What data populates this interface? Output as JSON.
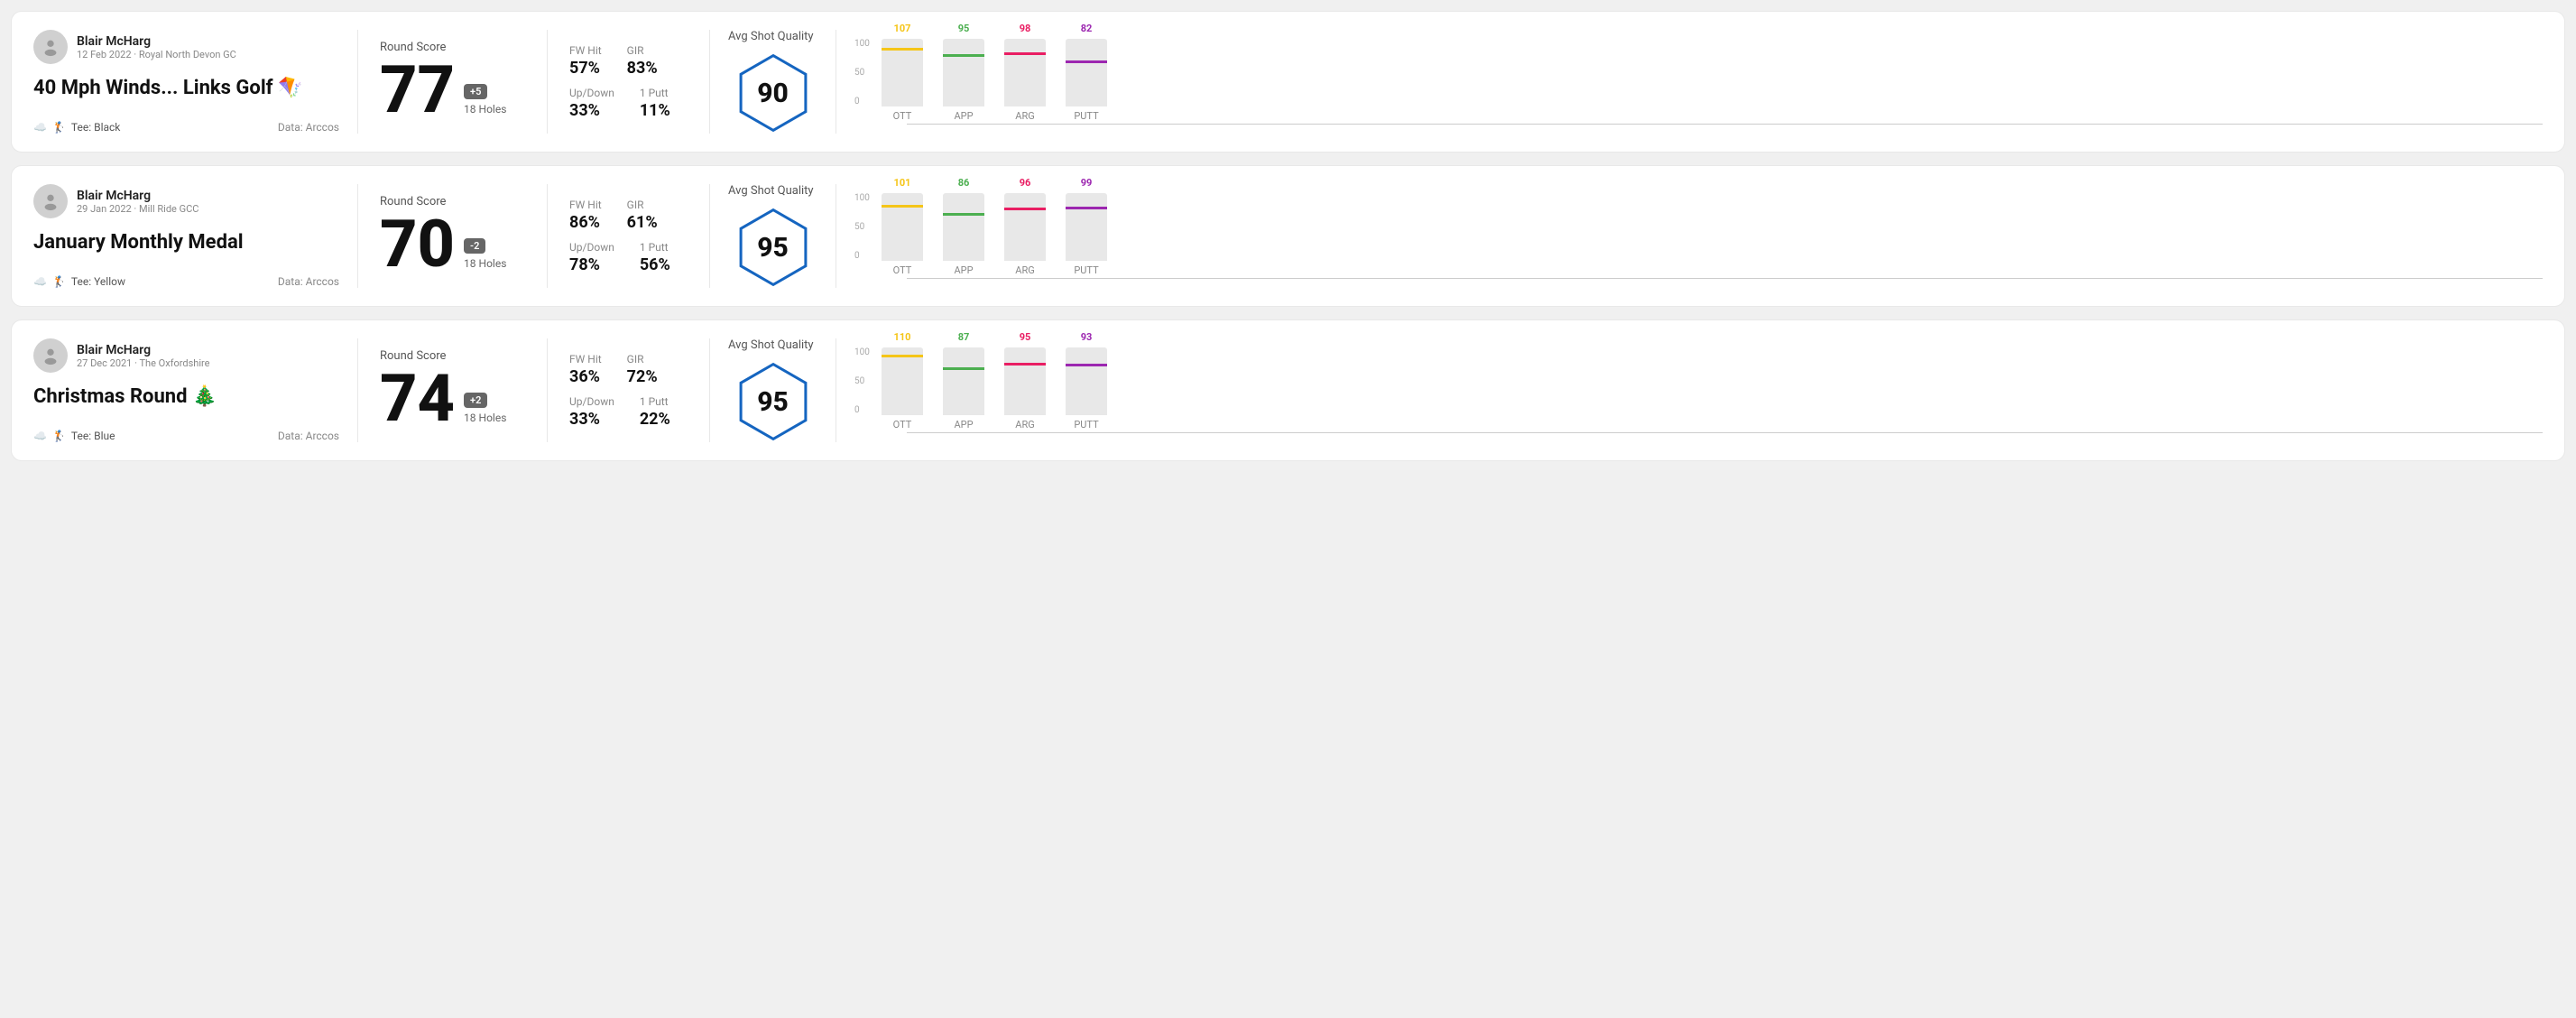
{
  "rounds": [
    {
      "id": "round-1",
      "user": {
        "name": "Blair McHarg",
        "meta": "12 Feb 2022 · Royal North Devon GC"
      },
      "title": "40 Mph Winds... Links Golf 🪁",
      "tee": "Black",
      "data_source": "Data: Arccos",
      "score": "77",
      "score_diff": "+5",
      "holes": "18 Holes",
      "fw_hit": "57%",
      "gir": "83%",
      "up_down": "33%",
      "one_putt": "11%",
      "avg_quality": "90",
      "chart": {
        "bars": [
          {
            "label": "OTT",
            "value": 107,
            "color": "#f5c518",
            "pct": 75
          },
          {
            "label": "APP",
            "value": 95,
            "color": "#4caf50",
            "pct": 65
          },
          {
            "label": "ARG",
            "value": 98,
            "color": "#e91e63",
            "pct": 68
          },
          {
            "label": "PUTT",
            "value": 82,
            "color": "#9c27b0",
            "pct": 55
          }
        ]
      }
    },
    {
      "id": "round-2",
      "user": {
        "name": "Blair McHarg",
        "meta": "29 Jan 2022 · Mill Ride GCC"
      },
      "title": "January Monthly Medal",
      "tee": "Yellow",
      "data_source": "Data: Arccos",
      "score": "70",
      "score_diff": "-2",
      "holes": "18 Holes",
      "fw_hit": "86%",
      "gir": "61%",
      "up_down": "78%",
      "one_putt": "56%",
      "avg_quality": "95",
      "chart": {
        "bars": [
          {
            "label": "OTT",
            "value": 101,
            "color": "#f5c518",
            "pct": 72
          },
          {
            "label": "APP",
            "value": 86,
            "color": "#4caf50",
            "pct": 58
          },
          {
            "label": "ARG",
            "value": 96,
            "color": "#e91e63",
            "pct": 67
          },
          {
            "label": "PUTT",
            "value": 99,
            "color": "#9c27b0",
            "pct": 70
          }
        ]
      }
    },
    {
      "id": "round-3",
      "user": {
        "name": "Blair McHarg",
        "meta": "27 Dec 2021 · The Oxfordshire"
      },
      "title": "Christmas Round 🎄",
      "tee": "Blue",
      "data_source": "Data: Arccos",
      "score": "74",
      "score_diff": "+2",
      "holes": "18 Holes",
      "fw_hit": "36%",
      "gir": "72%",
      "up_down": "33%",
      "one_putt": "22%",
      "avg_quality": "95",
      "chart": {
        "bars": [
          {
            "label": "OTT",
            "value": 110,
            "color": "#f5c518",
            "pct": 78
          },
          {
            "label": "APP",
            "value": 87,
            "color": "#4caf50",
            "pct": 59
          },
          {
            "label": "ARG",
            "value": 95,
            "color": "#e91e63",
            "pct": 66
          },
          {
            "label": "PUTT",
            "value": 93,
            "color": "#9c27b0",
            "pct": 65
          }
        ]
      }
    }
  ],
  "labels": {
    "round_score": "Round Score",
    "fw_hit": "FW Hit",
    "gir": "GIR",
    "up_down": "Up/Down",
    "one_putt": "1 Putt",
    "avg_quality": "Avg Shot Quality",
    "tee_prefix": "Tee:",
    "y100": "100",
    "y50": "50",
    "y0": "0"
  }
}
